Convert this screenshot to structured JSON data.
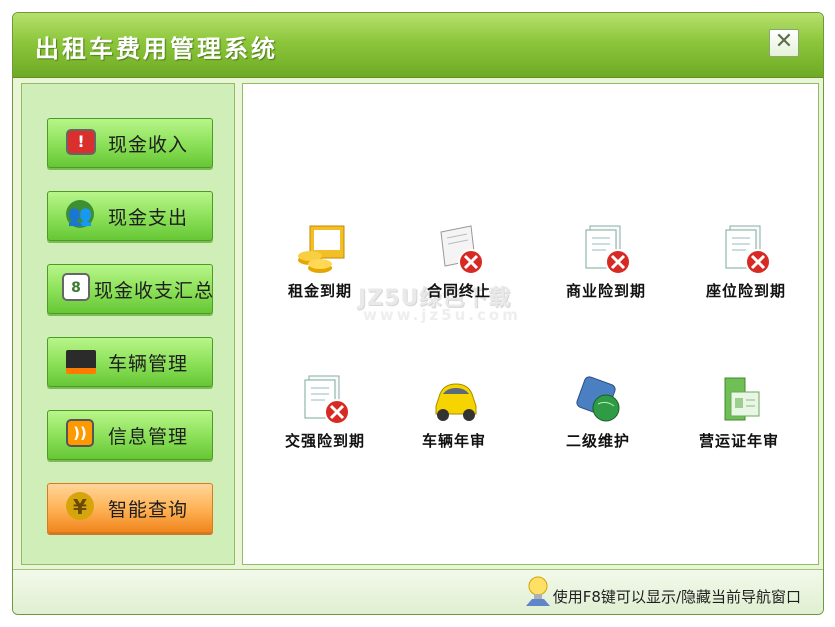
{
  "window": {
    "title": "出租车费用管理系统"
  },
  "sidebar": {
    "items": [
      {
        "label": "现金收入",
        "icon": "alert-icon"
      },
      {
        "label": "现金支出",
        "icon": "users-icon"
      },
      {
        "label": "现金收支汇总",
        "icon": "contacts-icon"
      },
      {
        "label": "车辆管理",
        "icon": "monitor-icon"
      },
      {
        "label": "信息管理",
        "icon": "rss-icon"
      },
      {
        "label": "智能查询",
        "icon": "coins-icon"
      }
    ],
    "active_index": 5
  },
  "tiles": [
    {
      "label": "租金到期",
      "icon": "coins-folder-icon"
    },
    {
      "label": "合同终止",
      "icon": "contract-cancel-icon"
    },
    {
      "label": "商业险到期",
      "icon": "insurance-cancel-icon"
    },
    {
      "label": "座位险到期",
      "icon": "insurance-cancel-icon"
    },
    {
      "label": "交强险到期",
      "icon": "insurance-cancel-icon"
    },
    {
      "label": "车辆年审",
      "icon": "car-icon"
    },
    {
      "label": "二级维护",
      "icon": "globe-maintenance-icon"
    },
    {
      "label": "营运证年审",
      "icon": "license-folder-icon"
    }
  ],
  "watermark": {
    "brand": "JZ5U绿色下载",
    "url": "www.jz5u.com"
  },
  "status": {
    "text": "使用F8键可以显示/隐藏当前导航窗口",
    "icon": "lightbulb-icon"
  }
}
